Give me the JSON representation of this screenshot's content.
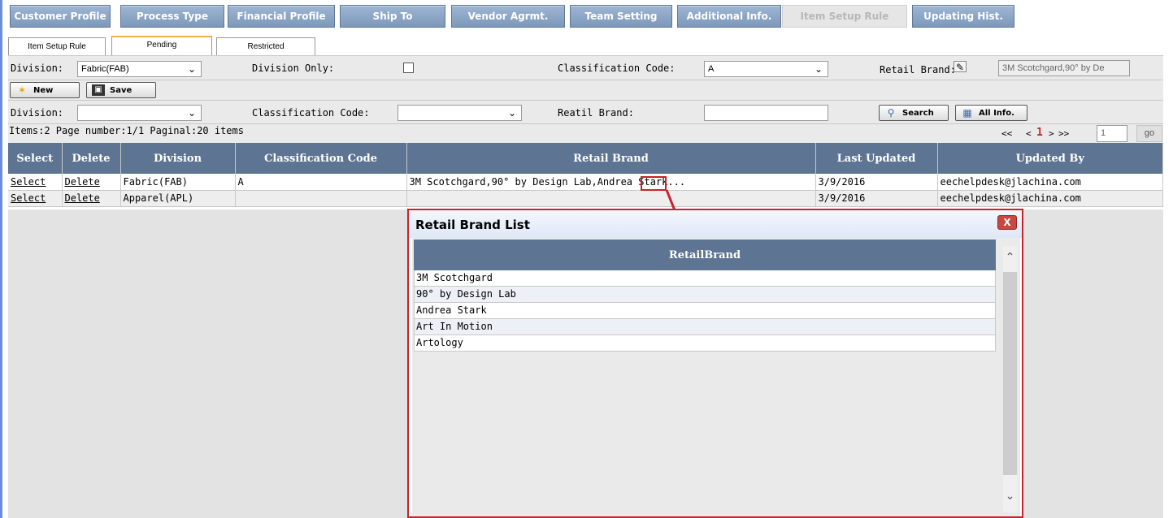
{
  "topnav": [
    "Customer Profile",
    "Process Type",
    "Financial Profile",
    "Ship To",
    "Vendor Agrmt.",
    "Team Setting",
    "Additional Info.",
    "Item Setup Rule",
    "Updating Hist."
  ],
  "tabs": [
    "Item Setup Rule",
    "Pending",
    "Restricted"
  ],
  "form1": {
    "division_label": "Division:",
    "division_value": "Fabric(FAB)",
    "division_only_label": "Division Only:",
    "class_code_label": "Classification Code:",
    "class_code_value": "A",
    "retail_brand_label": "Retail Brand:",
    "retail_brand_value": "3M Scotchgard,90° by De"
  },
  "actions": {
    "new": "New",
    "save": "Save"
  },
  "form2": {
    "division_label": "Division:",
    "class_code_label": "Classification Code:",
    "retail_brand_label": "Reatil Brand:",
    "search": "Search",
    "all_info": "All Info."
  },
  "paging": {
    "summary": "Items:2  Page number:1/1  Paginal:20 items",
    "first": "<<",
    "prev": "<",
    "current": "1",
    "next": ">",
    "last": ">>",
    "page_input": "1",
    "go": "go"
  },
  "grid": {
    "columns": [
      "Select",
      "Delete",
      "Division",
      "Classification Code",
      "Retail Brand",
      "Last Updated",
      "Updated By"
    ],
    "rows": [
      {
        "select": "Select",
        "delete": "Delete",
        "division": "Fabric(FAB)",
        "class_code": "A",
        "retail_brand": "3M Scotchgard,90° by Design Lab,Andrea Stark...",
        "last_updated": "3/9/2016",
        "updated_by": "eechelpdesk@jlachina.com"
      },
      {
        "select": "Select",
        "delete": "Delete",
        "division": "Apparel(APL)",
        "class_code": "",
        "retail_brand": "",
        "last_updated": "3/9/2016",
        "updated_by": "eechelpdesk@jlachina.com"
      }
    ]
  },
  "popup": {
    "title": "Retail Brand List",
    "close": "X",
    "column": "RetailBrand",
    "items": [
      "3M Scotchgard",
      "90° by Design Lab",
      "Andrea Stark",
      "Art In Motion",
      "Artology"
    ]
  },
  "colors": {
    "header_bg": "#5d7593",
    "nav_bg": "#8aa3c4",
    "highlight": "#c8232b",
    "active_tab": "#f0b341"
  },
  "icons": {
    "new": "star-icon",
    "save": "floppy-disk-icon",
    "search": "magnifier-icon",
    "all_info": "grid-icon",
    "edit": "edit-icon"
  }
}
